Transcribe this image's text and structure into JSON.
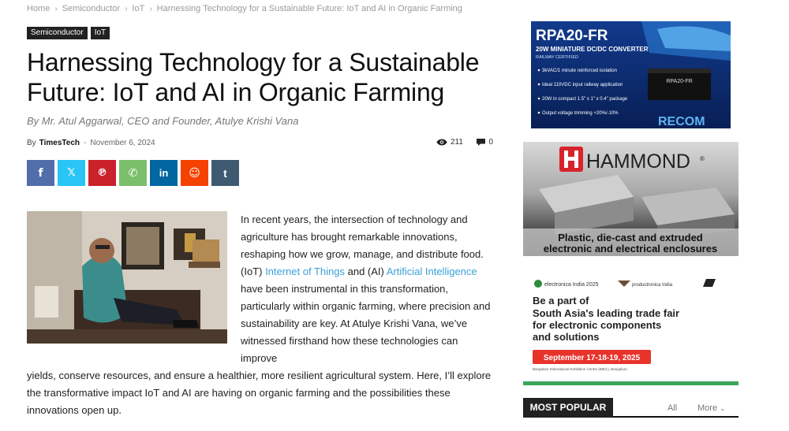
{
  "breadcrumb": {
    "home": "Home",
    "sep": "›",
    "semiconductor": "Semiconductor",
    "iot": "IoT",
    "current": "Harnessing Technology for a Sustainable Future: IoT and AI in Organic Farming"
  },
  "categories": [
    "Semiconductor",
    "IoT"
  ],
  "article": {
    "title": "Harnessing Technology for a Sustainable Future: IoT and AI in Organic Farming",
    "subtitle": "By Mr. Atul Aggarwal, CEO and Founder, Atulye Krishi Vana",
    "by_label": "By",
    "author": "TimesTech",
    "dash": "-",
    "date": "November 6, 2024",
    "views": "211",
    "comments": "0",
    "p1_a": "In recent years, the intersection of technology and agriculture has brought remarkable innovations, reshaping how we grow, manage, and distribute food. (IoT) ",
    "p1_link1": "Internet of Things",
    "p1_b": " and (AI) ",
    "p1_link2": "Artificial Intelligence",
    "p1_c": " have been instrumental in this transformation, particularly within organic farming, where precision and sustainability are key. At Atulye Krishi Vana, we’ve witnessed firsthand how these technologies can improve",
    "p1_d": "yields, conserve resources, and ensure a healthier, more resilient agricultural system. Here, I’ll explore the transformative impact IoT and AI are having on organic farming and the possibilities these innovations open up."
  },
  "share": [
    {
      "icon": "facebook-icon",
      "glyph": "f",
      "color": "#516eab"
    },
    {
      "icon": "x-icon",
      "glyph": "𝕏",
      "color": "#29c5f6"
    },
    {
      "icon": "pinterest-icon",
      "glyph": "℗",
      "color": "#ca212a"
    },
    {
      "icon": "whatsapp-icon",
      "glyph": "✆",
      "color": "#7bbf6a"
    },
    {
      "icon": "linkedin-icon",
      "glyph": "in",
      "color": "#0266a0"
    },
    {
      "icon": "reddit-icon",
      "glyph": "☺",
      "color": "#f54200"
    },
    {
      "icon": "tumblr-icon",
      "glyph": "t",
      "color": "#3e5a70"
    }
  ],
  "ads": {
    "recom": {
      "title": "RPA20-FR",
      "subtitle": "20W MINIATURE DC/DC CONVERTER",
      "tag": "RAILWAY CERTIFIED",
      "bullets": [
        "3kVAC/1 minute reinforced isolation",
        "Ideal 110VDC input railway application",
        "20W in compact 1.5\" x 1\" x 0.4\" package",
        "Output voltage trimming +20%/-10%"
      ],
      "brand": "RECOM",
      "chip": "RPA20-FR"
    },
    "hammond": {
      "brand": "HAMMOND",
      "reg": "®",
      "line1": "Plastic, die-cast and extruded",
      "line2": "electronic and electrical enclosures"
    },
    "electronica": {
      "logo1": "electronica India 2025",
      "logo2": "productronica India",
      "headline": [
        "Be a part of",
        "South Asia's leading trade fair",
        "for electronic components",
        "and solutions"
      ],
      "dates": "September 17-18-19, 2025",
      "venue": "Bangalore International Exhibition Centre (BIEC), Bengaluru"
    }
  },
  "most_popular": {
    "title": "MOST POPULAR",
    "all": "All",
    "more": "More"
  }
}
